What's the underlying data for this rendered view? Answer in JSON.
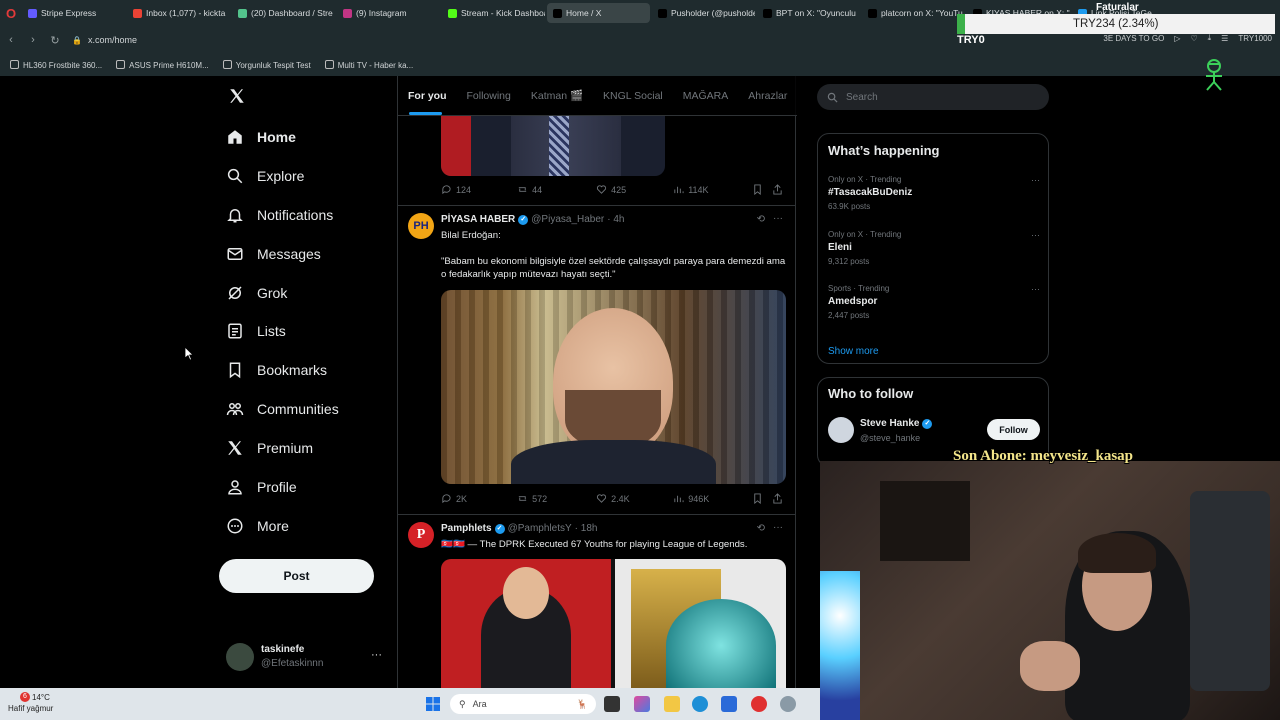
{
  "browser": {
    "tabs": [
      {
        "title": "Stripe Express",
        "color": "#635bff",
        "active": false
      },
      {
        "title": "Inbox (1,077) - kickta",
        "color": "#ea4335",
        "active": false
      },
      {
        "title": "(20) Dashboard / Stre",
        "color": "#53c38c",
        "active": false
      },
      {
        "title": "(9) Instagram",
        "color": "#c13584",
        "active": false
      },
      {
        "title": "Stream - Kick Dashboa",
        "color": "#53fc18",
        "active": false
      },
      {
        "title": "Home / X",
        "color": "#000000",
        "active": true
      },
      {
        "title": "Pusholder (@pusholde",
        "color": "#000000",
        "active": false
      },
      {
        "title": "BPT on X: \"Oyunculu",
        "color": "#000000",
        "active": false
      },
      {
        "title": "platcorn on X: \"YouTu",
        "color": "#000000",
        "active": false
      },
      {
        "title": "KIYAS HABER on X: \"D",
        "color": "#000000",
        "active": false
      },
      {
        "title": "Link Polisi TeGe...",
        "color": "#1d9bf0",
        "active": false
      }
    ],
    "url": "x.com/home",
    "bookmarks": [
      "HL360 Frostbite 360...",
      "ASUS Prime H610M...",
      "Yorgunluk Tespit Test",
      "Multi TV - Haber ka..."
    ],
    "right_controls": [
      "3E DAYS TO GO",
      "TRY1000"
    ]
  },
  "overlay": {
    "label": "Faturalar",
    "amount": "TRY234 (2.34%)",
    "progress": 0.0234,
    "start": "TRY0",
    "accent": "#3cb04a",
    "subscriber": "Son Abone: meyvesiz_kasap"
  },
  "sidebar": {
    "items": [
      {
        "label": "Home",
        "icon": "home-icon",
        "active": true
      },
      {
        "label": "Explore",
        "icon": "search-icon",
        "active": false
      },
      {
        "label": "Notifications",
        "icon": "bell-icon",
        "active": false
      },
      {
        "label": "Messages",
        "icon": "envelope-icon",
        "active": false
      },
      {
        "label": "Grok",
        "icon": "grok-icon",
        "active": false
      },
      {
        "label": "Lists",
        "icon": "list-icon",
        "active": false
      },
      {
        "label": "Bookmarks",
        "icon": "bookmark-icon",
        "active": false
      },
      {
        "label": "Communities",
        "icon": "people-icon",
        "active": false
      },
      {
        "label": "Premium",
        "icon": "x-logo-icon",
        "active": false
      },
      {
        "label": "Profile",
        "icon": "person-icon",
        "active": false
      },
      {
        "label": "More",
        "icon": "more-circle-icon",
        "active": false
      }
    ],
    "post_label": "Post",
    "account": {
      "name": "taskinefe",
      "handle": "@Efetaskinnn"
    }
  },
  "timeline": {
    "tabs": [
      "For you",
      "Following",
      "Katman 🎬",
      "KNGL Social",
      "MAĞARA",
      "Ahrazlar"
    ],
    "first_actions": {
      "replies": "124",
      "reposts": "44",
      "likes": "425",
      "views": "114K"
    },
    "tweets": [
      {
        "avatar_text": "PH",
        "name": "PİYASA HABER",
        "handle": "@Piyasa_Haber",
        "time": "· 4h",
        "line1": "Bilal Erdoğan:",
        "line2": "\"Babam bu ekonomi bilgisiyle özel sektörde çalışsaydı paraya  para demezdi ama o fedakarlık yapıp mütevazı hayatı seçti.\"",
        "actions": {
          "replies": "2K",
          "reposts": "572",
          "likes": "2.4K",
          "views": "946K"
        }
      },
      {
        "avatar_text": "P",
        "name": "Pamphlets",
        "handle": "@PamphletsY",
        "time": "· 18h",
        "line1": "🇰🇵🇰🇵 — The DPRK Executed 67 Youths for playing League of Legends."
      }
    ]
  },
  "right": {
    "search_placeholder": "Search",
    "happening_title": "What’s happening",
    "trends": [
      {
        "context": "Only on X · Trending",
        "name": "#TasacakBuDeniz",
        "count": "63.9K posts"
      },
      {
        "context": "Only on X · Trending",
        "name": "Eleni",
        "count": "9,312 posts"
      },
      {
        "context": "Sports · Trending",
        "name": "Amedspor",
        "count": "2,447 posts"
      }
    ],
    "show_more": "Show more",
    "follow_title": "Who to follow",
    "follow": {
      "name": "Steve Hanke",
      "handle": "@steve_hanke",
      "button": "Follow"
    }
  },
  "taskbar": {
    "temp": "14°C",
    "weather": "Hafif yağmur",
    "badge": "6",
    "search_placeholder": "Ara"
  }
}
